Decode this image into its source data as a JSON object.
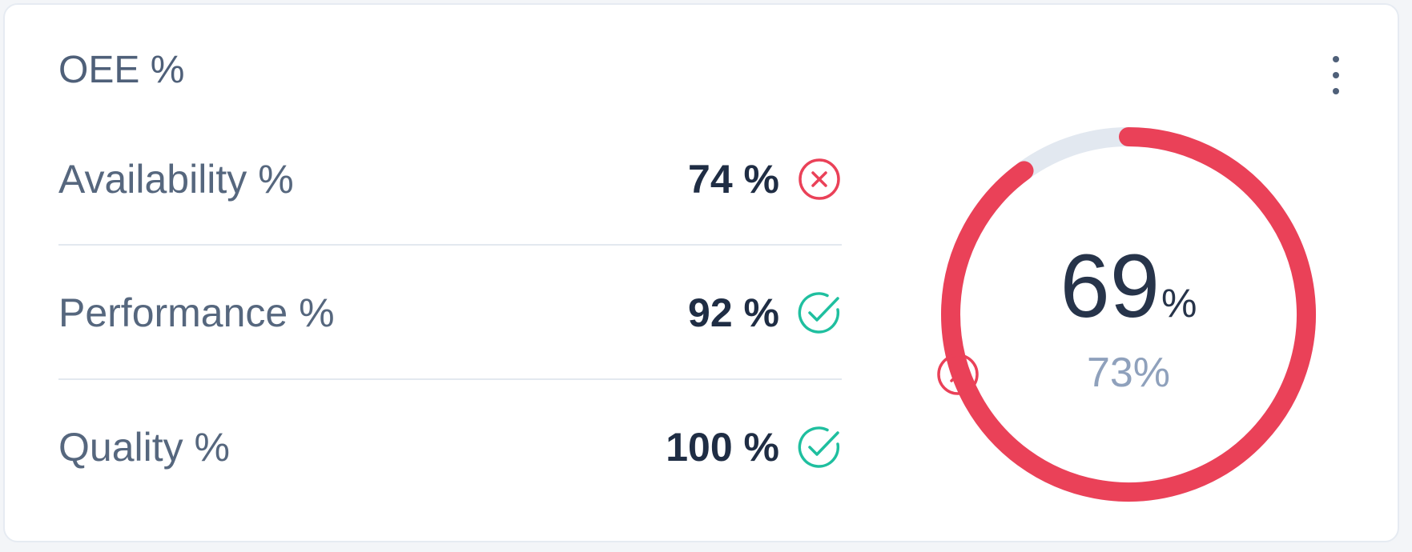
{
  "widget": {
    "title": "OEE %",
    "menu_icon": "more-vertical-icon"
  },
  "metrics": [
    {
      "label": "Availability %",
      "value": "74 %",
      "status": "fail",
      "status_icon": "x-circle-icon"
    },
    {
      "label": "Performance %",
      "value": "92 %",
      "status": "pass",
      "status_icon": "check-circle-icon"
    },
    {
      "label": "Quality %",
      "value": "100 %",
      "status": "pass",
      "status_icon": "check-circle-icon"
    }
  ],
  "gauge": {
    "value": "69",
    "unit": "%",
    "fraction": 0.9,
    "target": "73%",
    "target_status": "fail",
    "target_icon": "x-circle-icon"
  },
  "colors": {
    "danger": "#ea4158",
    "success": "#1fbf9f",
    "track": "#e2e8f0",
    "text_dark": "#1f2d44",
    "text_muted": "#8fa1bc"
  }
}
